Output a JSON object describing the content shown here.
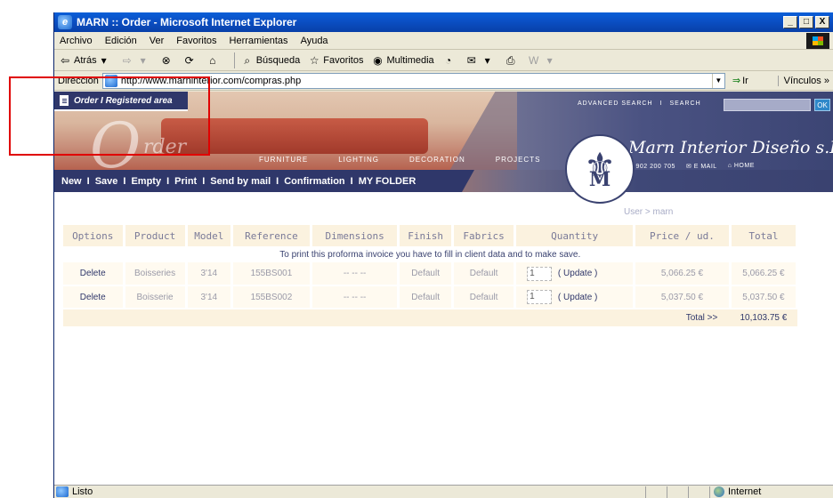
{
  "window": {
    "title": "MARN :: Order - Microsoft Internet Explorer",
    "controls": {
      "minimize": "_",
      "maximize": "□",
      "close": "X"
    }
  },
  "menu": {
    "items": [
      {
        "label": "Archivo",
        "icon": ""
      },
      {
        "label": "Edición"
      },
      {
        "label": "Ver"
      },
      {
        "label": "Favoritos"
      },
      {
        "label": "Herramientas"
      },
      {
        "label": "Ayuda"
      }
    ]
  },
  "toolbar": {
    "back": "Atrás",
    "search": "Búsqueda",
    "favorites": "Favoritos",
    "media": "Multimedia"
  },
  "address": {
    "label": "Dirección",
    "url": "http://www.marninterior.com/compras.php",
    "go": "Ir",
    "links": "Vínculos"
  },
  "site": {
    "order_tab": "Order I Registered area",
    "categories": [
      "FURNITURE",
      "LIGHTING",
      "DECORATION",
      "PROJECTS"
    ],
    "top_links": {
      "advanced_search": "ADVANCED SEARCH",
      "search": "SEARCH",
      "ok": "OK"
    },
    "brand": "Marn Interior Diseño s.L",
    "contact": {
      "phone": "+34 902 200 705",
      "email": "E MAIL",
      "home": "HOME"
    },
    "actions": [
      "New",
      "Save",
      "Empty",
      "Print",
      "Send by mail",
      "Confirmation",
      "MY FOLDER"
    ],
    "user_label": "User > marn"
  },
  "table": {
    "headers": [
      "Options",
      "Product",
      "Model",
      "Reference",
      "Dimensions",
      "Finish",
      "Fabrics",
      "Quantity",
      "Price / ud.",
      "Total"
    ],
    "notice": "To print this proforma invoice you have to fill in client data and to make save.",
    "rows": [
      {
        "option": "Delete",
        "product": "Boisseries",
        "model": "3'14",
        "reference": "155BS001",
        "dimensions": "-- -- --",
        "finish": "Default",
        "fabrics": "Default",
        "qty": "1",
        "update": "( Update )",
        "price": "5,066.25 €",
        "total": "5,066.25 €"
      },
      {
        "option": "Delete",
        "product": "Boisserie",
        "model": "3'14",
        "reference": "155BS002",
        "dimensions": "-- -- --",
        "finish": "Default",
        "fabrics": "Default",
        "qty": "1",
        "update": "( Update )",
        "price": "5,037.50 €",
        "total": "5,037.50 €"
      }
    ],
    "total_label": "Total >>",
    "total_value": "10,103.75 €"
  },
  "status": {
    "text": "Listo",
    "zone": "Internet"
  },
  "colors": {
    "navy": "#2f376a",
    "annotation": "#e00000"
  }
}
